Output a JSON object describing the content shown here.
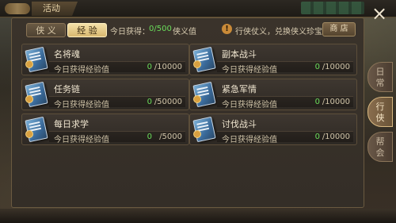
{
  "window": {
    "title": "活动",
    "close_icon": "×"
  },
  "tabs": [
    {
      "label": "侠 义",
      "active": false
    },
    {
      "label": "经 验",
      "active": true
    }
  ],
  "header": {
    "today_label": "今日获得：",
    "today_value": "0/500",
    "today_unit": "侠义值",
    "info_icon": "!",
    "info_text": "行侠仗义，兑换侠义珍宝",
    "shop_label": "商 店"
  },
  "activities": [
    {
      "name": "名将魂",
      "exp_label": "今日获得经验值",
      "current": "0",
      "max": "/10000"
    },
    {
      "name": "副本战斗",
      "exp_label": "今日获得经验值",
      "current": "0",
      "max": "/10000"
    },
    {
      "name": "任务链",
      "exp_label": "今日获得经验值",
      "current": "0",
      "max": "/50000"
    },
    {
      "name": "紧急军情",
      "exp_label": "今日获得经验值",
      "current": "0",
      "max": "/10000"
    },
    {
      "name": "每日求学",
      "exp_label": "今日获得经验值",
      "current": "0",
      "max": "/5000"
    },
    {
      "name": "讨伐战斗",
      "exp_label": "今日获得经验值",
      "current": "0",
      "max": "/10000"
    }
  ],
  "side_tabs": [
    {
      "line1": "日",
      "line2": "常",
      "active": false
    },
    {
      "line1": "行",
      "line2": "侠",
      "active": true
    },
    {
      "line1": "帮",
      "line2": "会",
      "active": false
    }
  ],
  "colors": {
    "accent_green": "#6adc5a",
    "gold": "#d8b870",
    "panel": "#3a332b"
  }
}
